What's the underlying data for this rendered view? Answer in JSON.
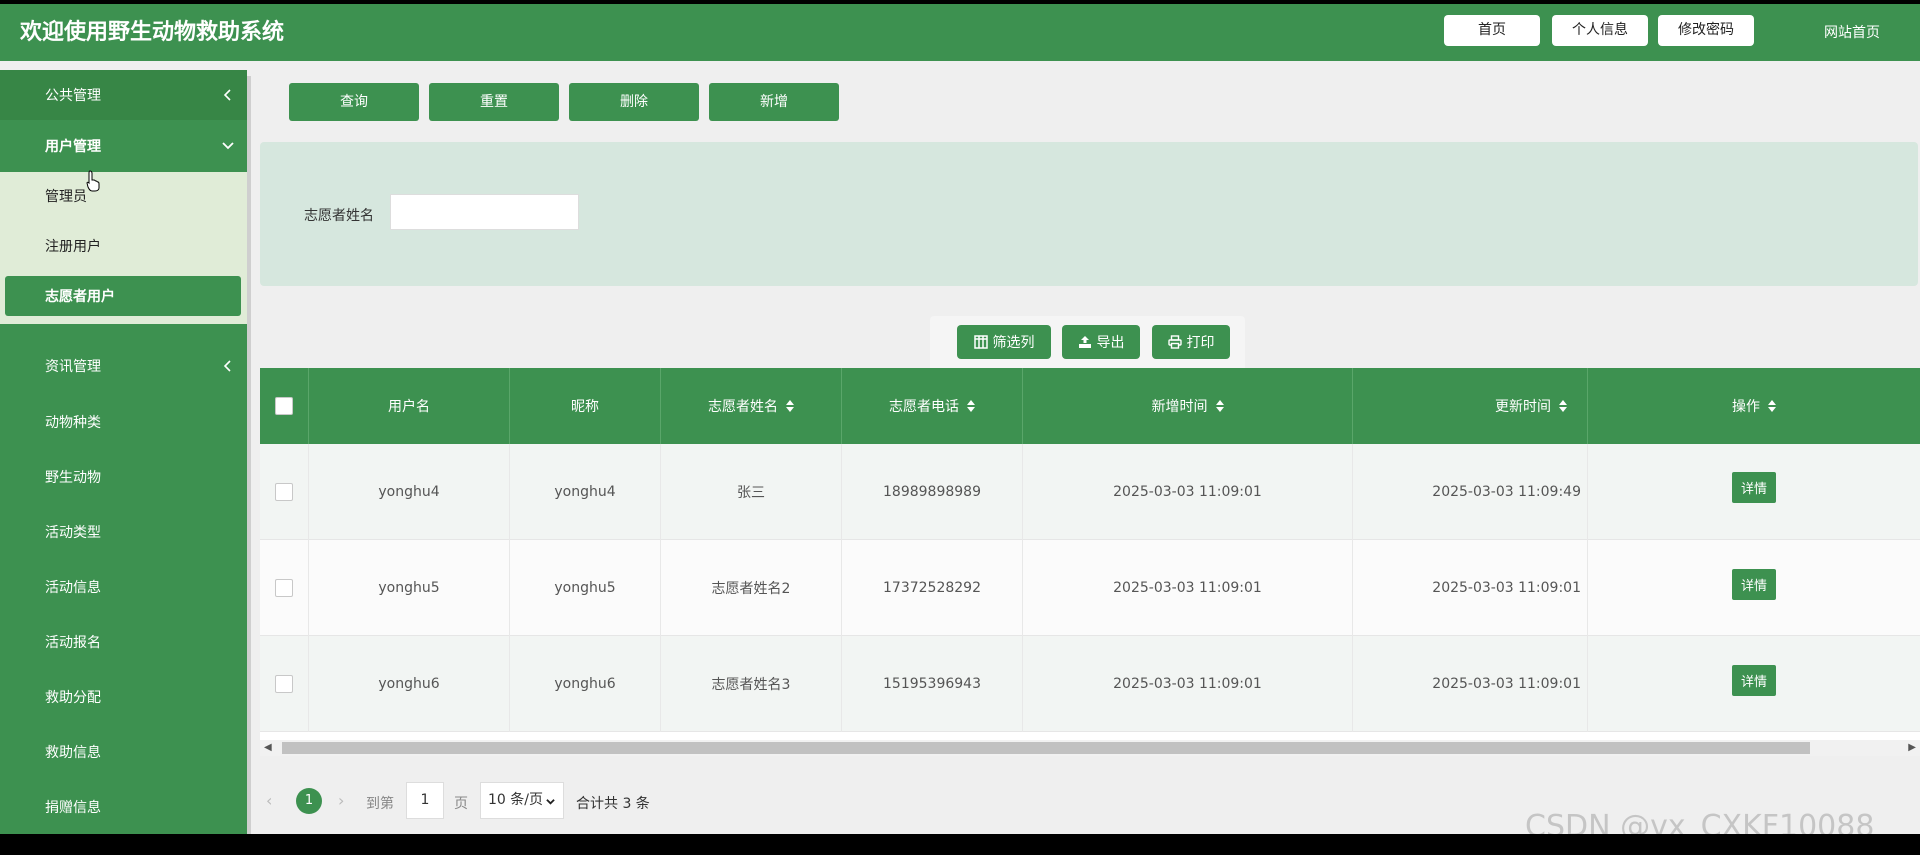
{
  "app": {
    "title": "欢迎使用野生动物救助系统",
    "header_buttons": {
      "home": "首页",
      "profile": "个人信息",
      "password": "修改密码"
    },
    "site_link": "网站首页"
  },
  "sidebar": {
    "groups": [
      {
        "label": "公共管理"
      },
      {
        "label": "用户管理"
      },
      {
        "label": "资讯管理"
      }
    ],
    "sub_items": [
      {
        "label": "管理员"
      },
      {
        "label": "注册用户"
      },
      {
        "label": "志愿者用户"
      }
    ],
    "items": [
      {
        "label": "动物种类"
      },
      {
        "label": "野生动物"
      },
      {
        "label": "活动类型"
      },
      {
        "label": "活动信息"
      },
      {
        "label": "活动报名"
      },
      {
        "label": "救助分配"
      },
      {
        "label": "救助信息"
      },
      {
        "label": "捐赠信息"
      }
    ]
  },
  "toolbar": {
    "query": "查询",
    "reset": "重置",
    "delete": "删除",
    "add": "新增"
  },
  "search": {
    "label": "志愿者姓名",
    "value": ""
  },
  "actions": {
    "filter_columns": "筛选列",
    "export": "导出",
    "print": "打印"
  },
  "table": {
    "columns": [
      "用户名",
      "昵称",
      "志愿者姓名",
      "志愿者电话",
      "新增时间",
      "更新时间",
      "操作"
    ],
    "rows": [
      {
        "username": "yonghu4",
        "nickname": "yonghu4",
        "name": "张三",
        "phone": "18989898989",
        "created": "2025-03-03 11:09:01",
        "updated": "2025-03-03 11:09:49",
        "action": "详情"
      },
      {
        "username": "yonghu5",
        "nickname": "yonghu5",
        "name": "志愿者姓名2",
        "phone": "17372528292",
        "created": "2025-03-03 11:09:01",
        "updated": "2025-03-03 11:09:01",
        "action": "详情"
      },
      {
        "username": "yonghu6",
        "nickname": "yonghu6",
        "name": "志愿者姓名3",
        "phone": "15195396943",
        "created": "2025-03-03 11:09:01",
        "updated": "2025-03-03 11:09:01",
        "action": "详情"
      }
    ]
  },
  "pagination": {
    "current_page": "1",
    "goto_label": "到第",
    "goto_value": "1",
    "page_suffix": "页",
    "page_size": "10 条/页",
    "total": "合计共 3 条"
  },
  "watermark": "CSDN @vx_CXKF10088",
  "colors": {
    "primary": "#3d9150",
    "panel": "#d6e7de",
    "submenu": "#e0ecd7"
  }
}
